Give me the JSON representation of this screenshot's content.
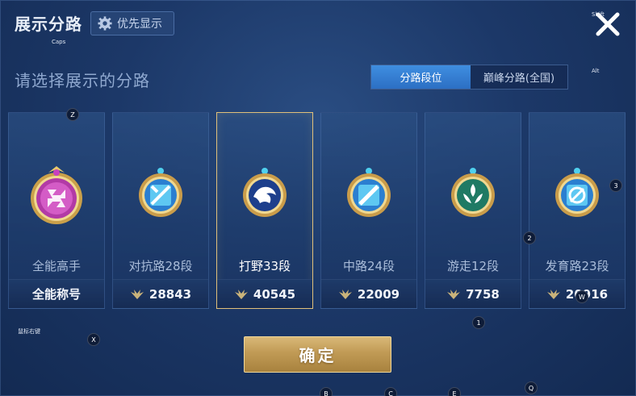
{
  "header": {
    "title": "展示分路",
    "priority_label": "优先显示",
    "close_icon": "close-icon"
  },
  "subtitle": "请选择展示的分路",
  "tabs": [
    {
      "label": "分路段位",
      "active": true
    },
    {
      "label": "巅峰分路(全国)",
      "active": false
    }
  ],
  "cards": [
    {
      "role": "全能高手",
      "score": "全能称号",
      "has_wing": false,
      "emblem": "all-round-emblem-icon",
      "color": "#c23fb0"
    },
    {
      "role": "对抗路28段",
      "score": "28843",
      "has_wing": true,
      "emblem": "clash-lane-emblem-icon",
      "color": "#3fa7e0"
    },
    {
      "role": "打野33段",
      "score": "40545",
      "has_wing": true,
      "emblem": "jungle-emblem-icon",
      "color": "#3d6fd8"
    },
    {
      "role": "中路24段",
      "score": "22009",
      "has_wing": true,
      "emblem": "mid-lane-emblem-icon",
      "color": "#3fa7e0"
    },
    {
      "role": "游走12段",
      "score": "7758",
      "has_wing": true,
      "emblem": "roam-emblem-icon",
      "color": "#2f9a7a"
    },
    {
      "role": "发育路23段",
      "score": "20916",
      "has_wing": true,
      "emblem": "farm-lane-emblem-icon",
      "color": "#3fa7e0"
    }
  ],
  "selected_index": 2,
  "confirm_label": "确定",
  "key_hints": {
    "shift": "Shift",
    "caps": "Caps",
    "z": "Z",
    "x": "X",
    "num1": "1",
    "num2": "2",
    "num3": "3",
    "w": "W",
    "q": "Q",
    "b": "B",
    "c": "C",
    "e": "E",
    "mouse_right": "鼠标右键",
    "top_right_hint": "Alt"
  }
}
